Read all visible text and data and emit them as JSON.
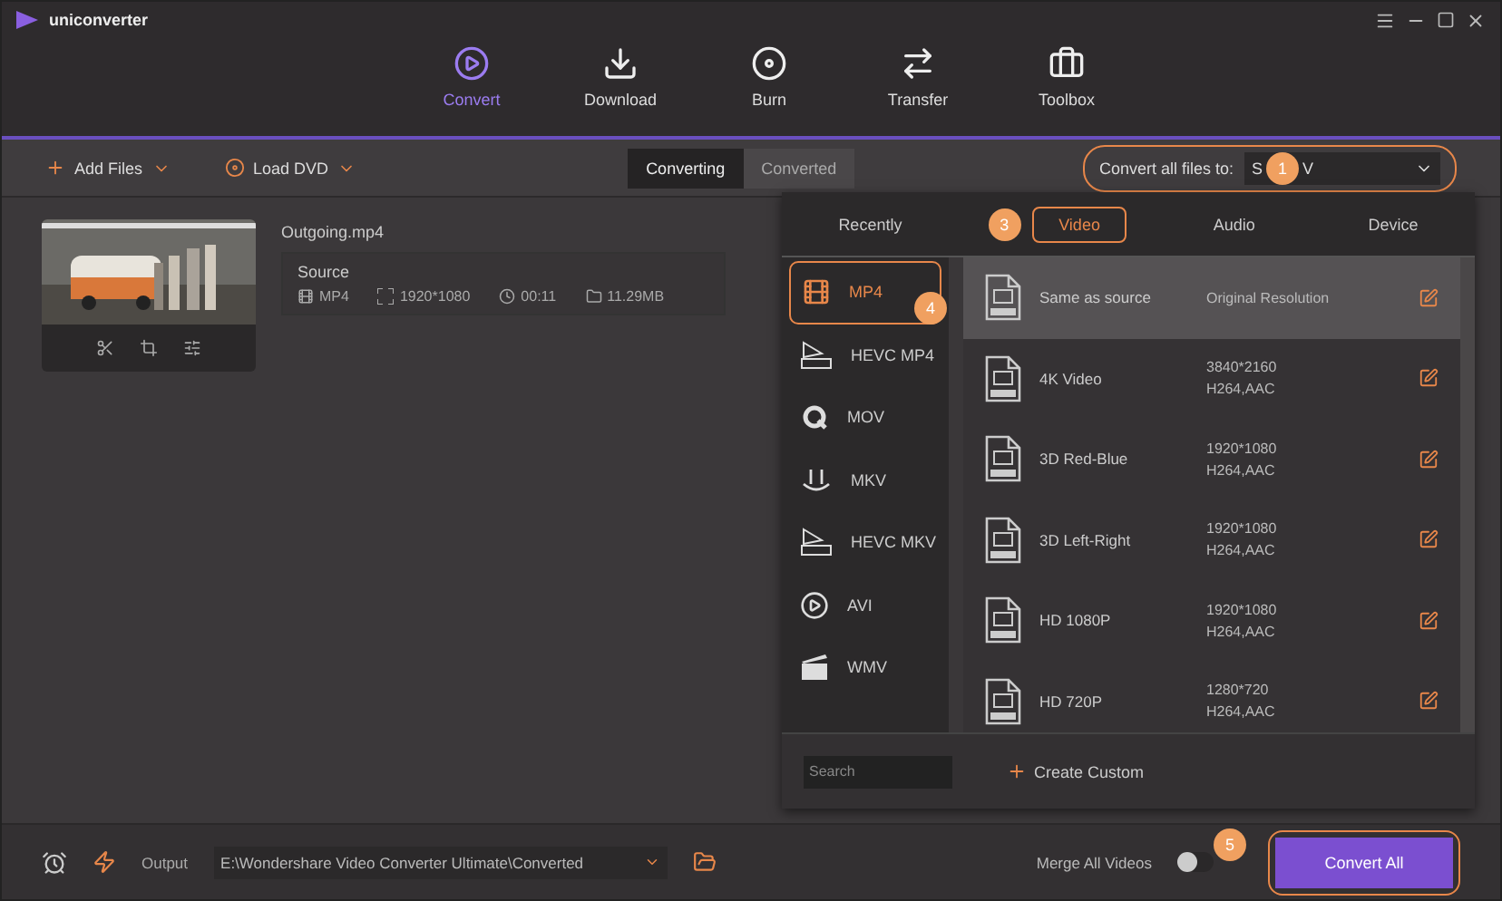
{
  "app": {
    "title": "uniconverter"
  },
  "nav": [
    {
      "label": "Convert",
      "selected": true
    },
    {
      "label": "Download",
      "selected": false
    },
    {
      "label": "Burn",
      "selected": false
    },
    {
      "label": "Transfer",
      "selected": false
    },
    {
      "label": "Toolbox",
      "selected": false
    }
  ],
  "toolbar": {
    "add_files": "Add Files",
    "load_dvd": "Load DVD",
    "tabs": [
      {
        "label": "Converting",
        "selected": true
      },
      {
        "label": "Converted",
        "selected": false
      }
    ],
    "convert_all": {
      "label": "Convert all files to:",
      "value_start": "S",
      "value_end": "V",
      "badge": "1"
    }
  },
  "file": {
    "name": "Outgoing.mp4",
    "source_label": "Source",
    "format": "MP4",
    "resolution": "1920*1080",
    "duration": "00:11",
    "size": "11.29MB"
  },
  "format_panel": {
    "tabs": [
      {
        "label": "Recently",
        "selected": false
      },
      {
        "label": "Video",
        "selected": true,
        "badge": "3"
      },
      {
        "label": "Audio",
        "selected": false
      },
      {
        "label": "Device",
        "selected": false
      }
    ],
    "formats": [
      {
        "label": "MP4",
        "selected": true,
        "badge": "4"
      },
      {
        "label": "HEVC MP4",
        "selected": false
      },
      {
        "label": "MOV",
        "selected": false
      },
      {
        "label": "MKV",
        "selected": false
      },
      {
        "label": "HEVC MKV",
        "selected": false
      },
      {
        "label": "AVI",
        "selected": false
      },
      {
        "label": "WMV",
        "selected": false
      }
    ],
    "presets": [
      {
        "name": "Same as source",
        "detail": [
          "Original Resolution"
        ],
        "selected": true
      },
      {
        "name": "4K Video",
        "detail": [
          "3840*2160",
          "H264,AAC"
        ],
        "selected": false
      },
      {
        "name": "3D Red-Blue",
        "detail": [
          "1920*1080",
          "H264,AAC"
        ],
        "selected": false
      },
      {
        "name": "3D Left-Right",
        "detail": [
          "1920*1080",
          "H264,AAC"
        ],
        "selected": false
      },
      {
        "name": "HD 1080P",
        "detail": [
          "1920*1080",
          "H264,AAC"
        ],
        "selected": false
      },
      {
        "name": "HD 720P",
        "detail": [
          "1280*720",
          "H264,AAC"
        ],
        "selected": false
      }
    ],
    "search_placeholder": "Search",
    "create_custom": "Create Custom"
  },
  "bottom": {
    "output_label": "Output",
    "output_path": "E:\\Wondershare Video Converter Ultimate\\Converted",
    "merge_label": "Merge All Videos",
    "merge_on": false,
    "convert_button": "Convert All",
    "badge": "5"
  }
}
